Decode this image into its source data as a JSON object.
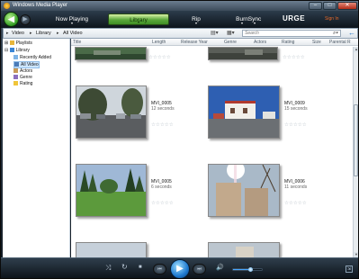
{
  "window": {
    "title": "Windows Media Player"
  },
  "window_controls": {
    "minimize": "–",
    "maximize": "□",
    "close": "✕"
  },
  "nav": {
    "back": "◀",
    "forward": "▶",
    "tabs": [
      {
        "label": "Now Playing",
        "active": false
      },
      {
        "label": "Library",
        "active": true
      },
      {
        "label": "Rip",
        "active": false
      },
      {
        "label": "Burn",
        "active": false
      },
      {
        "label": "Sync",
        "active": false
      }
    ],
    "brand": "URGE",
    "sign_in": "Sign In"
  },
  "address": {
    "crumbs": [
      "Video",
      "Library",
      "All Video"
    ],
    "search_placeholder": "Search"
  },
  "tree": {
    "items": [
      {
        "label": "Playlists",
        "level": 0,
        "toggle": "⊞",
        "selected": false
      },
      {
        "label": "Library",
        "level": 0,
        "toggle": "⊟",
        "selected": false
      },
      {
        "label": "Recently Added",
        "level": 1,
        "selected": false
      },
      {
        "label": "All Video",
        "level": 1,
        "selected": true
      },
      {
        "label": "Actors",
        "level": 1,
        "selected": false
      },
      {
        "label": "Genre",
        "level": 1,
        "selected": false
      },
      {
        "label": "Rating",
        "level": 1,
        "selected": false
      }
    ]
  },
  "columns": [
    "Title",
    "Length",
    "Release Year",
    "Genre",
    "Actors",
    "Rating",
    "Size",
    "Parental R"
  ],
  "videos": [
    {
      "name": "MVI_0005",
      "duration": "12 seconds",
      "rating": "☆☆☆☆☆"
    },
    {
      "name": "MVI_0009",
      "duration": "15 seconds",
      "rating": "☆☆☆☆☆"
    },
    {
      "name": "MVI_0005",
      "duration": "6 seconds",
      "rating": "☆☆☆☆☆"
    },
    {
      "name": "MVI_0006",
      "duration": "11 seconds",
      "rating": "☆☆☆☆☆"
    }
  ],
  "top_ratings": [
    "☆☆☆☆☆",
    "☆☆☆☆☆"
  ],
  "controls": {
    "shuffle": "⤨",
    "repeat": "↻",
    "stop": "■",
    "previous": "⏮",
    "play": "▶",
    "next": "⏭",
    "mute": "🔊",
    "volume": 0.62
  },
  "colors": {
    "tab_active": "#5aa83a",
    "play": "#1f7ad0",
    "brand_signin": "#e86a2a"
  }
}
